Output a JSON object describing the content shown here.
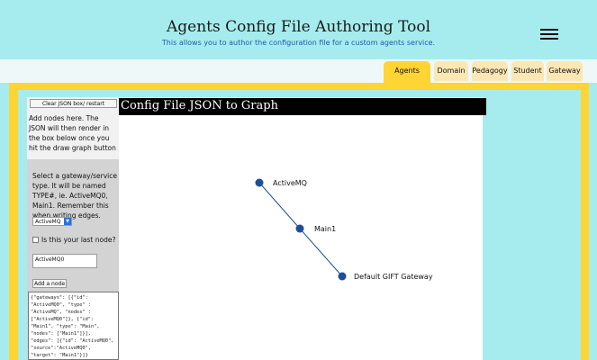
{
  "header": {
    "title": "Agents Config File Authoring Tool",
    "subtitle": "This allows you to author the configuration file for a custom agents service."
  },
  "tabs": [
    {
      "label": "Agents",
      "active": true
    },
    {
      "label": "Domain",
      "active": false
    },
    {
      "label": "Pedagogy",
      "active": false
    },
    {
      "label": "Student",
      "active": false
    },
    {
      "label": "Gateway",
      "active": false
    }
  ],
  "sidebar": {
    "clear_button": "Clear JSON box/ restart",
    "instructions": "Add nodes here. The JSON will then render in the box below once you hit the draw graph button",
    "select_instructions": "Select a gateway/service type. It will be named TYPE#, ie. ActiveMQ0, Main1. Remember this when writing edges.",
    "gateway_select_value": "ActiveMQ",
    "last_node_label": "Is this your last node?",
    "node_input_value": "ActiveMQ0",
    "add_node_button": "Add a node",
    "json_text": "{\"gateways\": [{\"id\": \"ActiveMQ0\", \"type\" : \"ActiveMQ\", \"nodes\" : [\"ActiveMQ0\"]}, {\"id\": \"Main1\", \"type\": \"Main\", \"nodes\": [\"Main1\"]}], \"edges\": [{\"id\": \"ActiveMQ0\", \"source\":\"ActiveMQ0\", \"target\": \"Main1\"}]}"
  },
  "graph": {
    "title": "Config File JSON to Graph",
    "node_color": "#1f4e9c",
    "nodes": [
      {
        "label": "ActiveMQ"
      },
      {
        "label": "Main1"
      },
      {
        "label": "Default GIFT Gateway"
      }
    ]
  },
  "colors": {
    "background": "#a6ecef",
    "accent": "#ffd433",
    "tab_inactive": "#fbe7b4"
  }
}
